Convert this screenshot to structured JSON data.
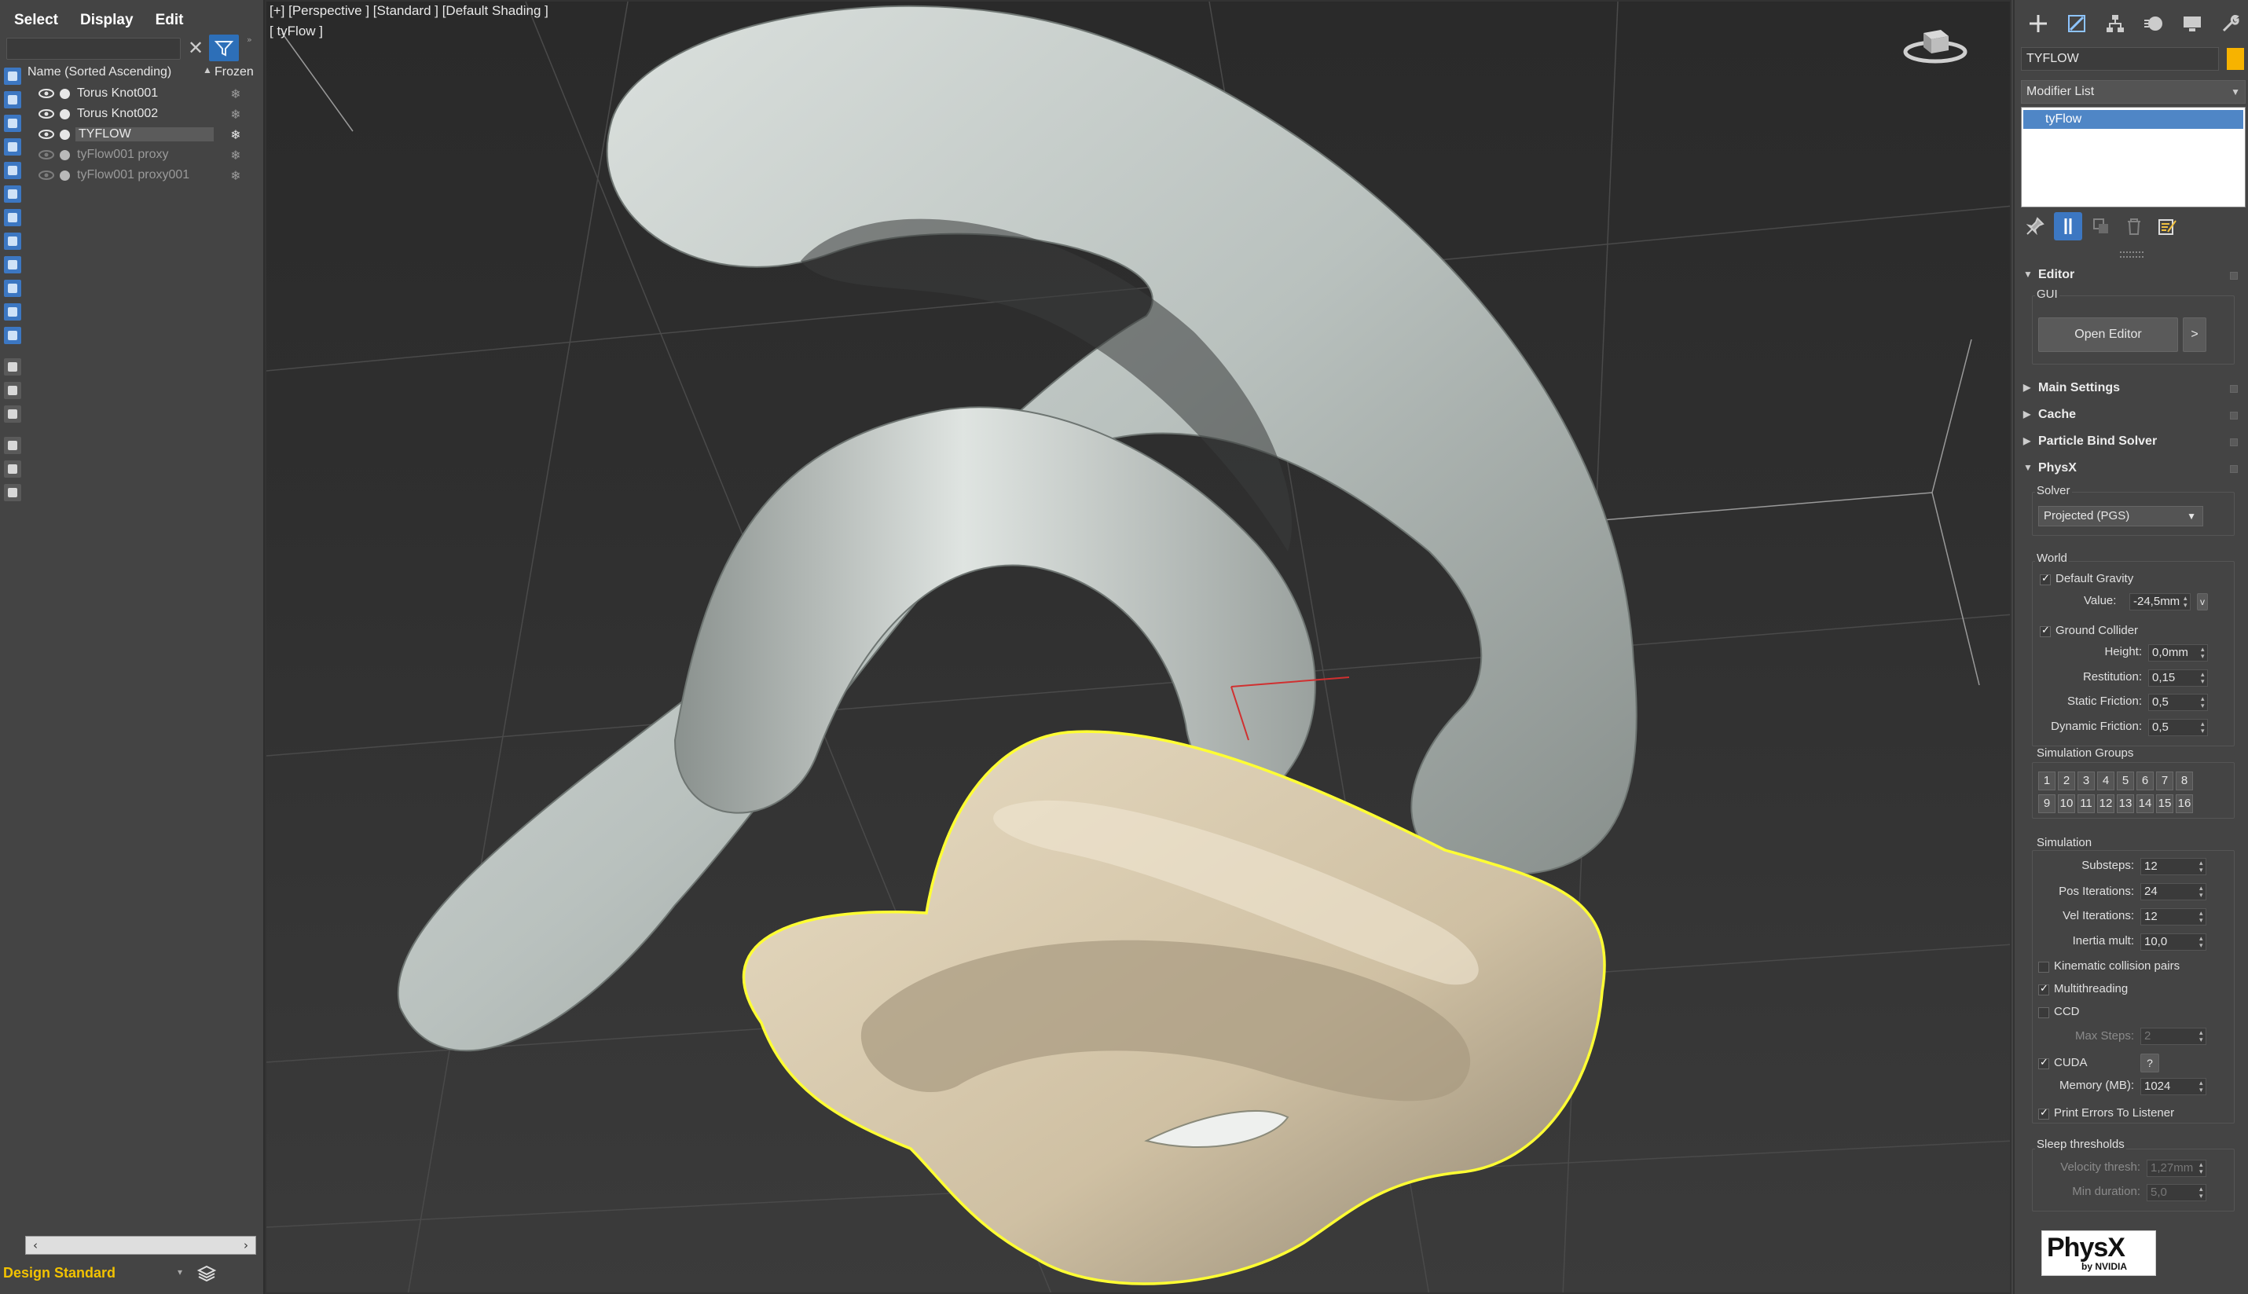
{
  "explorer": {
    "menu": [
      "Select",
      "Display",
      "Edit"
    ],
    "header_name": "Name (Sorted Ascending)",
    "header_sort_icon": "sort-ascending-icon",
    "header_frozen": "Frozen",
    "rows": [
      {
        "name": "Torus Knot001",
        "visible": true,
        "selected": false
      },
      {
        "name": "Torus Knot002",
        "visible": true,
        "selected": false
      },
      {
        "name": "TYFLOW",
        "visible": true,
        "selected": true
      },
      {
        "name": "tyFlow001 proxy",
        "visible": false,
        "selected": false
      },
      {
        "name": "tyFlow001 proxy001",
        "visible": false,
        "selected": false
      }
    ],
    "layer": "Design Standard"
  },
  "viewport": {
    "label": "[+] [Perspective ] [Standard ] [Default Shading ]",
    "object_label": "[ tyFlow ]",
    "colors": {
      "background": "#2c2c2c",
      "knot_gray": "#c9d0cd",
      "knot_tan": "#d8c9ad",
      "selection_outline": "#ffff33"
    }
  },
  "command_panel": {
    "object_name": "TYFLOW",
    "object_color": "#f7b300",
    "modifier_list": "Modifier List",
    "stack_item": "tyFlow",
    "editor": {
      "title": "Editor",
      "gui_label": "GUI",
      "open_editor": "Open Editor",
      "more": ">"
    },
    "rollouts": [
      "Main Settings",
      "Cache",
      "Particle Bind Solver"
    ],
    "physx": {
      "title": "PhysX",
      "solver_label": "Solver",
      "solver_value": "Projected (PGS)",
      "world_label": "World",
      "default_gravity": "Default Gravity",
      "value_label": "Value:",
      "value": "-24,5mm",
      "value_unit_button": "v",
      "ground_collider": "Ground Collider",
      "height_label": "Height:",
      "height": "0,0mm",
      "restitution_label": "Restitution:",
      "restitution": "0,15",
      "static_friction_label": "Static Friction:",
      "static_friction": "0,5",
      "dynamic_friction_label": "Dynamic Friction:",
      "dynamic_friction": "0,5",
      "sim_groups_label": "Simulation Groups",
      "sim_groups": [
        "1",
        "2",
        "3",
        "4",
        "5",
        "6",
        "7",
        "8",
        "9",
        "10",
        "11",
        "12",
        "13",
        "14",
        "15",
        "16"
      ],
      "simulation_label": "Simulation",
      "substeps_label": "Substeps:",
      "substeps": "12",
      "pos_iter_label": "Pos Iterations:",
      "pos_iter": "24",
      "vel_iter_label": "Vel Iterations:",
      "vel_iter": "12",
      "inertia_label": "Inertia mult:",
      "inertia": "10,0",
      "kinematic": "Kinematic collision pairs",
      "multithreading": "Multithreading",
      "ccd": "CCD",
      "max_steps_label": "Max Steps:",
      "max_steps": "2",
      "cuda": "CUDA",
      "cuda_help": "?",
      "memory_label": "Memory (MB):",
      "memory": "1024",
      "print_errors": "Print Errors To Listener",
      "sleep_label": "Sleep thresholds",
      "velocity_label": "Velocity thresh:",
      "velocity": "1,27mm",
      "min_duration_label": "Min duration:",
      "min_duration": "5,0",
      "logo_text": "PhysX",
      "logo_sub": "by NVIDIA"
    }
  }
}
